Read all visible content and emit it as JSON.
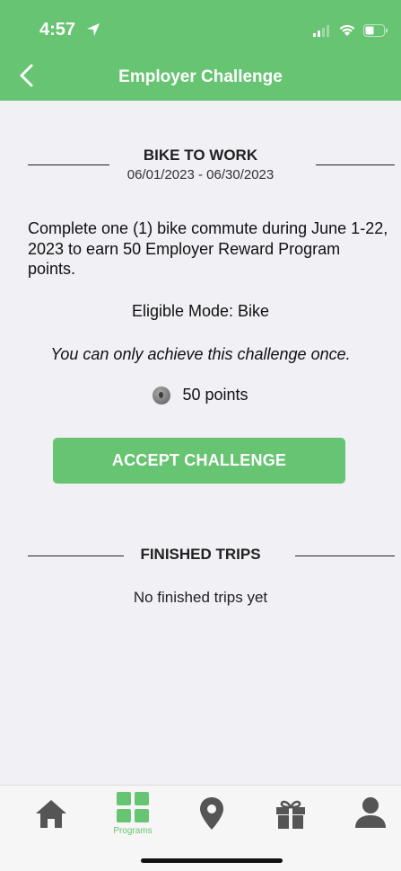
{
  "status_bar": {
    "time": "4:57"
  },
  "nav": {
    "title": "Employer Challenge"
  },
  "challenge": {
    "name": "BIKE TO WORK",
    "dates": "06/01/2023 - 06/30/2023",
    "description": "Complete one (1) bike commute during June 1-22, 2023 to earn 50 Employer Reward Program points.",
    "eligible_mode": "Eligible Mode: Bike",
    "once_note": "You can only achieve this challenge once.",
    "points": "50 points"
  },
  "actions": {
    "accept_label": "ACCEPT CHALLENGE"
  },
  "finished": {
    "title": "FINISHED TRIPS",
    "empty_text": "No finished trips yet"
  },
  "tabbar": {
    "programs_label": "Programs"
  },
  "colors": {
    "accent": "#67c472",
    "background": "#f0f0f5",
    "tab_icon": "#555555"
  }
}
